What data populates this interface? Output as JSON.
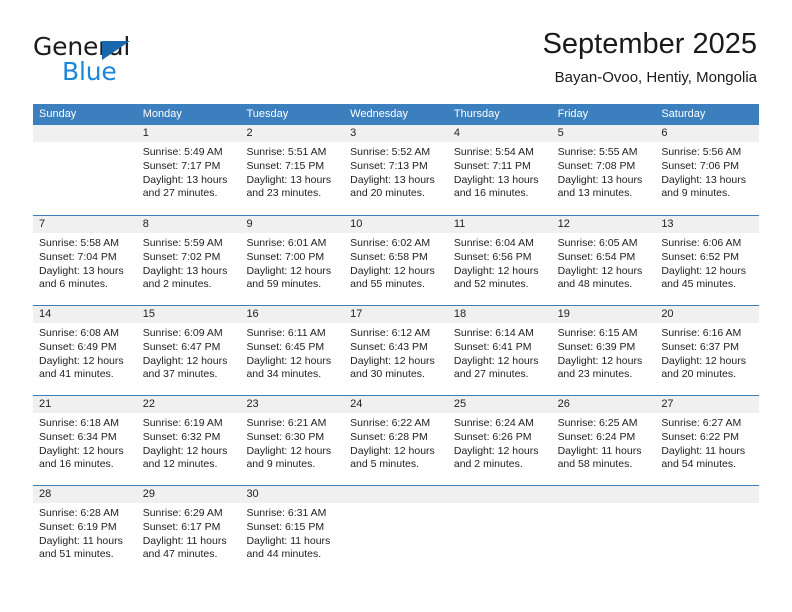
{
  "brand": {
    "name_top": "General",
    "name_bottom": "Blue",
    "triangle_color": "#1866ab",
    "blue_color": "#1c86d8"
  },
  "header": {
    "title": "September 2025",
    "subtitle": "Bayan-Ovoo, Hentiy, Mongolia"
  },
  "theme": {
    "header_blue": "#3b7fbe",
    "day_number_band": "#f0f0f0",
    "text": "#222222"
  },
  "weekdays": [
    "Sunday",
    "Monday",
    "Tuesday",
    "Wednesday",
    "Thursday",
    "Friday",
    "Saturday"
  ],
  "weeks": [
    [
      {
        "empty": true
      },
      {
        "day": "1",
        "sunrise": "Sunrise: 5:49 AM",
        "sunset": "Sunset: 7:17 PM",
        "daylight": "Daylight: 13 hours and 27 minutes."
      },
      {
        "day": "2",
        "sunrise": "Sunrise: 5:51 AM",
        "sunset": "Sunset: 7:15 PM",
        "daylight": "Daylight: 13 hours and 23 minutes."
      },
      {
        "day": "3",
        "sunrise": "Sunrise: 5:52 AM",
        "sunset": "Sunset: 7:13 PM",
        "daylight": "Daylight: 13 hours and 20 minutes."
      },
      {
        "day": "4",
        "sunrise": "Sunrise: 5:54 AM",
        "sunset": "Sunset: 7:11 PM",
        "daylight": "Daylight: 13 hours and 16 minutes."
      },
      {
        "day": "5",
        "sunrise": "Sunrise: 5:55 AM",
        "sunset": "Sunset: 7:08 PM",
        "daylight": "Daylight: 13 hours and 13 minutes."
      },
      {
        "day": "6",
        "sunrise": "Sunrise: 5:56 AM",
        "sunset": "Sunset: 7:06 PM",
        "daylight": "Daylight: 13 hours and 9 minutes."
      }
    ],
    [
      {
        "day": "7",
        "sunrise": "Sunrise: 5:58 AM",
        "sunset": "Sunset: 7:04 PM",
        "daylight": "Daylight: 13 hours and 6 minutes."
      },
      {
        "day": "8",
        "sunrise": "Sunrise: 5:59 AM",
        "sunset": "Sunset: 7:02 PM",
        "daylight": "Daylight: 13 hours and 2 minutes."
      },
      {
        "day": "9",
        "sunrise": "Sunrise: 6:01 AM",
        "sunset": "Sunset: 7:00 PM",
        "daylight": "Daylight: 12 hours and 59 minutes."
      },
      {
        "day": "10",
        "sunrise": "Sunrise: 6:02 AM",
        "sunset": "Sunset: 6:58 PM",
        "daylight": "Daylight: 12 hours and 55 minutes."
      },
      {
        "day": "11",
        "sunrise": "Sunrise: 6:04 AM",
        "sunset": "Sunset: 6:56 PM",
        "daylight": "Daylight: 12 hours and 52 minutes."
      },
      {
        "day": "12",
        "sunrise": "Sunrise: 6:05 AM",
        "sunset": "Sunset: 6:54 PM",
        "daylight": "Daylight: 12 hours and 48 minutes."
      },
      {
        "day": "13",
        "sunrise": "Sunrise: 6:06 AM",
        "sunset": "Sunset: 6:52 PM",
        "daylight": "Daylight: 12 hours and 45 minutes."
      }
    ],
    [
      {
        "day": "14",
        "sunrise": "Sunrise: 6:08 AM",
        "sunset": "Sunset: 6:49 PM",
        "daylight": "Daylight: 12 hours and 41 minutes."
      },
      {
        "day": "15",
        "sunrise": "Sunrise: 6:09 AM",
        "sunset": "Sunset: 6:47 PM",
        "daylight": "Daylight: 12 hours and 37 minutes."
      },
      {
        "day": "16",
        "sunrise": "Sunrise: 6:11 AM",
        "sunset": "Sunset: 6:45 PM",
        "daylight": "Daylight: 12 hours and 34 minutes."
      },
      {
        "day": "17",
        "sunrise": "Sunrise: 6:12 AM",
        "sunset": "Sunset: 6:43 PM",
        "daylight": "Daylight: 12 hours and 30 minutes."
      },
      {
        "day": "18",
        "sunrise": "Sunrise: 6:14 AM",
        "sunset": "Sunset: 6:41 PM",
        "daylight": "Daylight: 12 hours and 27 minutes."
      },
      {
        "day": "19",
        "sunrise": "Sunrise: 6:15 AM",
        "sunset": "Sunset: 6:39 PM",
        "daylight": "Daylight: 12 hours and 23 minutes."
      },
      {
        "day": "20",
        "sunrise": "Sunrise: 6:16 AM",
        "sunset": "Sunset: 6:37 PM",
        "daylight": "Daylight: 12 hours and 20 minutes."
      }
    ],
    [
      {
        "day": "21",
        "sunrise": "Sunrise: 6:18 AM",
        "sunset": "Sunset: 6:34 PM",
        "daylight": "Daylight: 12 hours and 16 minutes."
      },
      {
        "day": "22",
        "sunrise": "Sunrise: 6:19 AM",
        "sunset": "Sunset: 6:32 PM",
        "daylight": "Daylight: 12 hours and 12 minutes."
      },
      {
        "day": "23",
        "sunrise": "Sunrise: 6:21 AM",
        "sunset": "Sunset: 6:30 PM",
        "daylight": "Daylight: 12 hours and 9 minutes."
      },
      {
        "day": "24",
        "sunrise": "Sunrise: 6:22 AM",
        "sunset": "Sunset: 6:28 PM",
        "daylight": "Daylight: 12 hours and 5 minutes."
      },
      {
        "day": "25",
        "sunrise": "Sunrise: 6:24 AM",
        "sunset": "Sunset: 6:26 PM",
        "daylight": "Daylight: 12 hours and 2 minutes."
      },
      {
        "day": "26",
        "sunrise": "Sunrise: 6:25 AM",
        "sunset": "Sunset: 6:24 PM",
        "daylight": "Daylight: 11 hours and 58 minutes."
      },
      {
        "day": "27",
        "sunrise": "Sunrise: 6:27 AM",
        "sunset": "Sunset: 6:22 PM",
        "daylight": "Daylight: 11 hours and 54 minutes."
      }
    ],
    [
      {
        "day": "28",
        "sunrise": "Sunrise: 6:28 AM",
        "sunset": "Sunset: 6:19 PM",
        "daylight": "Daylight: 11 hours and 51 minutes."
      },
      {
        "day": "29",
        "sunrise": "Sunrise: 6:29 AM",
        "sunset": "Sunset: 6:17 PM",
        "daylight": "Daylight: 11 hours and 47 minutes."
      },
      {
        "day": "30",
        "sunrise": "Sunrise: 6:31 AM",
        "sunset": "Sunset: 6:15 PM",
        "daylight": "Daylight: 11 hours and 44 minutes."
      },
      {
        "empty": true
      },
      {
        "empty": true
      },
      {
        "empty": true
      },
      {
        "empty": true
      }
    ]
  ]
}
